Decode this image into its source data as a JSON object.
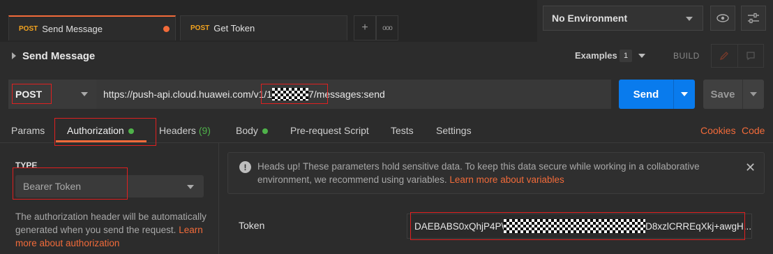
{
  "tabs": [
    {
      "method": "POST",
      "label": "Send Message",
      "active": true,
      "unsaved": true
    },
    {
      "method": "POST",
      "label": "Get Token",
      "active": false,
      "unsaved": false
    }
  ],
  "tab_buttons": {
    "add": "+",
    "more": "ooo"
  },
  "environment": {
    "selected": "No Environment"
  },
  "request": {
    "title": "Send Message",
    "examples_label": "Examples",
    "examples_count": "1",
    "build_label": "BUILD"
  },
  "url_bar": {
    "method": "POST",
    "url_prefix": "https://push-api.cloud.huawei.com/v1/1",
    "url_suffix": "7/messages:send",
    "send_label": "Send",
    "save_label": "Save"
  },
  "sub_tabs": {
    "params": "Params",
    "authorization": "Authorization",
    "headers": "Headers",
    "headers_count": "(9)",
    "body": "Body",
    "prerequest": "Pre-request Script",
    "tests": "Tests",
    "settings": "Settings",
    "cookies": "Cookies",
    "code": "Code"
  },
  "auth": {
    "type_label": "TYPE",
    "type_value": "Bearer Token",
    "help_text": "The authorization header will be automatically generated when you send the request.",
    "help_link": "Learn more about authorization"
  },
  "alert": {
    "text": "Heads up! These parameters hold sensitive data. To keep this data secure while working in a collaborative environment, we recommend using variables.",
    "link": "Learn more about variables"
  },
  "token": {
    "label": "Token",
    "value_prefix": "DAEBABS0xQhjP4P\\",
    "value_suffix": "D8xzlCRREqXkj+awgH..."
  },
  "colors": {
    "accent": "#f26b3a",
    "primary": "#097bed",
    "success": "#4fb24a",
    "method": "#f4a41f"
  }
}
